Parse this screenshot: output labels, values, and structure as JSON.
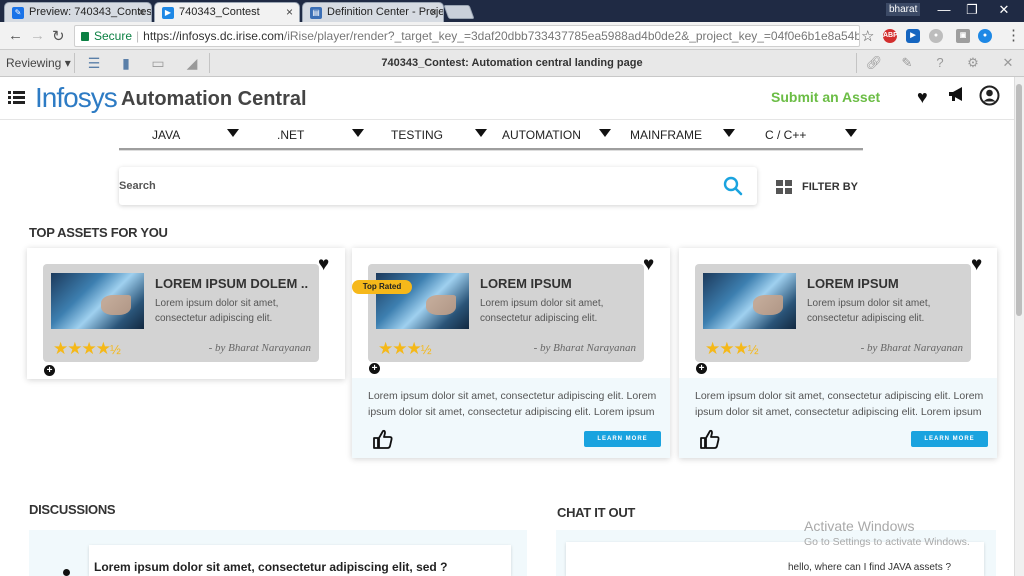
{
  "browser": {
    "tabs": [
      {
        "label": "Preview: 740343_Contest",
        "active": false
      },
      {
        "label": "740343_Contest",
        "active": true
      },
      {
        "label": "Definition Center - Proje",
        "active": false
      }
    ],
    "user": "bharat",
    "window_controls": {
      "minimize": "—",
      "restore": "❐",
      "close": "✕"
    },
    "address": {
      "secure_label": "Secure",
      "url_host": "https://infosys.dc.irise.com",
      "url_path": "/iRise/player/render?_target_key_=3daf20dbb733437785ea5988ad4b0de2&_project_key_=04f0e6b1e8a54bb5b78e607342712..."
    }
  },
  "irise_toolbar": {
    "mode": "Reviewing",
    "page_title": "740343_Contest: Automation central landing page"
  },
  "header": {
    "logo": "Infosys",
    "title": "Automation Central",
    "submit_label": "Submit an Asset"
  },
  "categories": [
    "JAVA",
    ".NET",
    "TESTING",
    "AUTOMATION",
    "MAINFRAME",
    "C / C++"
  ],
  "search": {
    "placeholder": "Search"
  },
  "filter_label": "FILTER BY",
  "sections": {
    "top_assets": "TOP ASSETS FOR YOU",
    "discussions": "DISCUSSIONS",
    "chat": "CHAT IT OUT"
  },
  "cards": [
    {
      "title": "LOREM IPSUM DOLEM ..",
      "desc": "Lorem ipsum dolor sit amet, consectetur adipiscing elit.",
      "stars": "★★★★",
      "half": "½",
      "rating": 4.5,
      "author": "- by Bharat Narayanan"
    },
    {
      "title": "LOREM IPSUM",
      "desc": "Lorem ipsum dolor sit amet, consectetur adipiscing elit.",
      "stars": "★★★",
      "half": "½",
      "rating": 3.5,
      "author": "- by Bharat Narayanan",
      "badge": "Top Rated",
      "expanded_text": "Lorem ipsum dolor sit amet, consectetur adipiscing elit. Lorem ipsum dolor sit amet, consectetur adipiscing elit. Lorem ipsum",
      "learn_more": "LEARN MORE"
    },
    {
      "title": "LOREM IPSUM",
      "desc": "Lorem ipsum dolor sit amet, consectetur adipiscing elit.",
      "stars": "★★★",
      "half": "½",
      "rating": 3.5,
      "author": "- by Bharat Narayanan",
      "expanded_text": "Lorem ipsum dolor sit amet, consectetur adipiscing elit. Lorem ipsum dolor sit amet, consectetur adipiscing elit. Lorem ipsum",
      "learn_more": "LEARN MORE"
    }
  ],
  "discussion_question": "Lorem ipsum dolor sit amet, consectetur adipiscing elit, sed ?",
  "chat_message": "hello, where can I find JAVA assets ?",
  "watermark": {
    "line1": "Activate Windows",
    "line2": "Go to Settings to activate Windows."
  },
  "colors": {
    "brand": "#2d7bc4",
    "submit": "#6bbd45",
    "accent": "#1aa3df",
    "star": "#f5b818",
    "badge": "#f6b81a"
  }
}
